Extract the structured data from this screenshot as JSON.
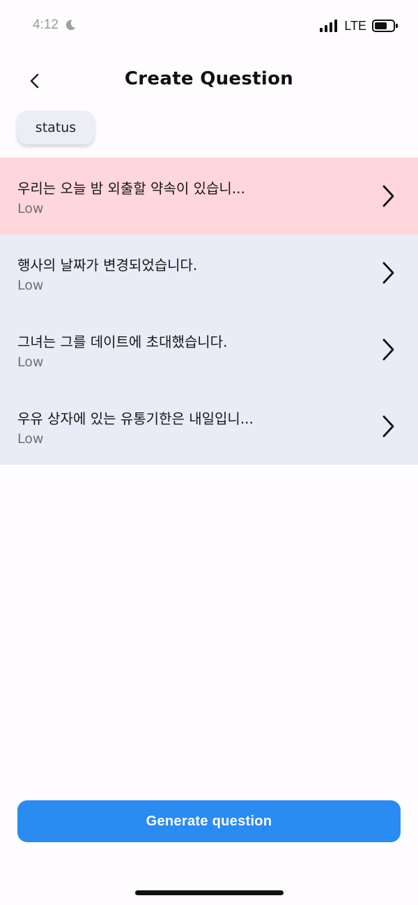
{
  "status_bar": {
    "time": "4:12",
    "network": "LTE",
    "icons": {
      "moon": "moon-icon",
      "signal": "signal-icon",
      "battery": "battery-icon"
    }
  },
  "nav": {
    "title": "Create Question",
    "back_icon": "chevron-left-icon"
  },
  "filter": {
    "chip_label": "status"
  },
  "questions": [
    {
      "text": "우리는 오늘 밤 외출할 약속이 있습니...",
      "level": "Low",
      "highlighted": true
    },
    {
      "text": "행사의 날짜가 변경되었습니다.",
      "level": "Low",
      "highlighted": false
    },
    {
      "text": "그녀는 그를 데이트에 초대했습니다.",
      "level": "Low",
      "highlighted": false
    },
    {
      "text": "우유 상자에 있는 유통기한은 내일입니...",
      "level": "Low",
      "highlighted": false
    }
  ],
  "actions": {
    "generate_label": "Generate question"
  },
  "colors": {
    "accent": "#2a8bf2",
    "highlight_row": "#ffd6db",
    "row": "#e9ecf6",
    "background": "#fefcfe"
  }
}
